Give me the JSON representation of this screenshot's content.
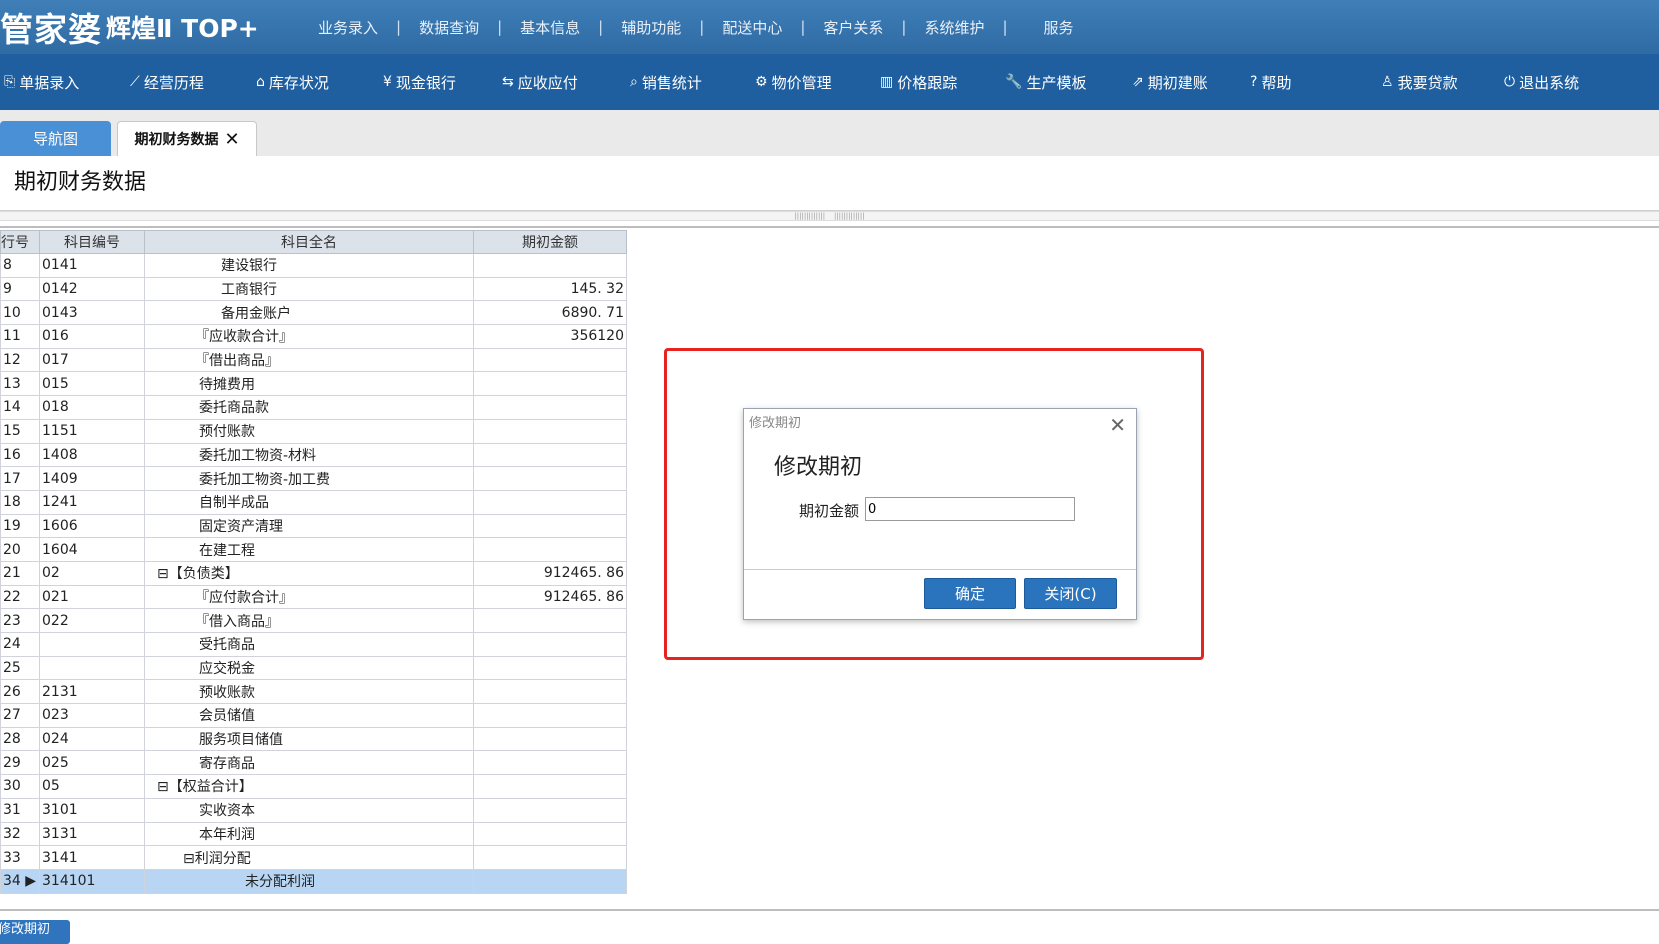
{
  "app": {
    "logo_main": "管家婆",
    "logo_sub": "辉煌Ⅱ TOP+",
    "top_menu": [
      "业务录入",
      "数据查询",
      "基本信息",
      "辅助功能",
      "配送中心",
      "客户关系",
      "系统维护",
      "服务"
    ]
  },
  "toolbar": [
    {
      "icon": "document-icon",
      "glyph": "⎘",
      "label": "单据录入"
    },
    {
      "icon": "chart-line-icon",
      "glyph": "⟋",
      "label": "经营历程"
    },
    {
      "icon": "home-icon",
      "glyph": "⌂",
      "label": "库存状况"
    },
    {
      "icon": "yen-icon",
      "glyph": "¥",
      "label": "现金银行"
    },
    {
      "icon": "exchange-icon",
      "glyph": "⇆",
      "label": "应收应付"
    },
    {
      "icon": "search-icon",
      "glyph": "⌕",
      "label": "销售统计"
    },
    {
      "icon": "gear-icon",
      "glyph": "⚙",
      "label": "物价管理"
    },
    {
      "icon": "bar-chart-icon",
      "glyph": "▥",
      "label": "价格跟踪"
    },
    {
      "icon": "wrench-icon",
      "glyph": "🔧",
      "label": "生产模板"
    },
    {
      "icon": "external-link-icon",
      "glyph": "⇗",
      "label": "期初建账"
    },
    {
      "icon": "question-icon",
      "glyph": "?",
      "label": "帮助"
    },
    {
      "icon": "money-bag-icon",
      "glyph": "♙",
      "label": "我要贷款"
    },
    {
      "icon": "power-icon",
      "glyph": "⏻",
      "label": "退出系统"
    }
  ],
  "tabs": {
    "nav": "导航图",
    "active": "期初财务数据",
    "close": "✕"
  },
  "page_title": "期初财务数据",
  "table": {
    "headers": [
      "行号",
      "科目编号",
      "科目全名",
      "期初金额"
    ],
    "rows": [
      {
        "no": "8",
        "code": "0141",
        "name": "建设银行",
        "amount": ""
      },
      {
        "no": "9",
        "code": "0142",
        "name": "工商银行",
        "amount": "145. 32"
      },
      {
        "no": "10",
        "code": "0143",
        "name": "备用金账户",
        "amount": "6890. 71"
      },
      {
        "no": "11",
        "code": "016",
        "name": "『应收款合计』",
        "amount": "356120"
      },
      {
        "no": "12",
        "code": "017",
        "name": "『借出商品』",
        "amount": ""
      },
      {
        "no": "13",
        "code": "015",
        "name": "待摊费用",
        "amount": ""
      },
      {
        "no": "14",
        "code": "018",
        "name": "委托商品款",
        "amount": ""
      },
      {
        "no": "15",
        "code": "1151",
        "name": "预付账款",
        "amount": ""
      },
      {
        "no": "16",
        "code": "1408",
        "name": "委托加工物资-材料",
        "amount": ""
      },
      {
        "no": "17",
        "code": "1409",
        "name": "委托加工物资-加工费",
        "amount": ""
      },
      {
        "no": "18",
        "code": "1241",
        "name": "自制半成品",
        "amount": ""
      },
      {
        "no": "19",
        "code": "1606",
        "name": "固定资产清理",
        "amount": ""
      },
      {
        "no": "20",
        "code": "1604",
        "name": "在建工程",
        "amount": ""
      },
      {
        "no": "21",
        "code": "02",
        "name": "⊟【负债类】",
        "amount": "912465. 86"
      },
      {
        "no": "22",
        "code": "021",
        "name": "『应付款合计』",
        "amount": "912465. 86"
      },
      {
        "no": "23",
        "code": "022",
        "name": "『借入商品』",
        "amount": ""
      },
      {
        "no": "24",
        "code": "",
        "name": "受托商品",
        "amount": ""
      },
      {
        "no": "25",
        "code": "",
        "name": "应交税金",
        "amount": ""
      },
      {
        "no": "26",
        "code": "2131",
        "name": "预收账款",
        "amount": ""
      },
      {
        "no": "27",
        "code": "023",
        "name": "会员储值",
        "amount": ""
      },
      {
        "no": "28",
        "code": "024",
        "name": "服务项目储值",
        "amount": ""
      },
      {
        "no": "29",
        "code": "025",
        "name": "寄存商品",
        "amount": ""
      },
      {
        "no": "30",
        "code": "05",
        "name": "⊟【权益合计】",
        "amount": ""
      },
      {
        "no": "31",
        "code": "3101",
        "name": "实收资本",
        "amount": ""
      },
      {
        "no": "32",
        "code": "3131",
        "name": "本年利润",
        "amount": ""
      },
      {
        "no": "33",
        "code": "3141",
        "name": "⊟利润分配",
        "amount": ""
      },
      {
        "no": "34 ▶",
        "code": "314101",
        "name": "未分配利润",
        "amount": ""
      }
    ]
  },
  "bottom_button": "修改期初",
  "dialog": {
    "window_title": "修改期初",
    "close_glyph": "✕",
    "heading": "修改期初",
    "field_label": "期初金额",
    "field_value": "0",
    "ok": "确定",
    "cancel": "关闭(C)"
  },
  "colors": {
    "topbar": "#3f7fb8",
    "toolbar": "#1f5f9f",
    "button": "#2a73bd",
    "selected_row": "#b8d6f4",
    "highlight": "#e8231f"
  }
}
